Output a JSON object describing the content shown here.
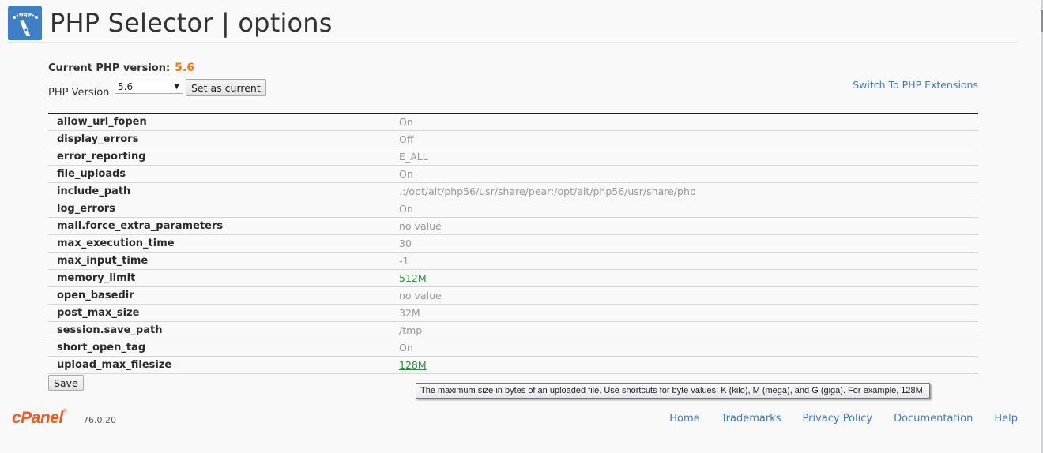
{
  "header": {
    "logo_icon": "php-selector-gauge-icon",
    "title": "PHP Selector | options"
  },
  "version": {
    "current_label": "Current PHP version:",
    "current_value": "5.6",
    "select_label": "PHP Version",
    "selected": "5.6",
    "set_current_label": "Set as current",
    "switch_link": "Switch To PHP Extensions"
  },
  "options": [
    {
      "name": "allow_url_fopen",
      "value": "On",
      "state": "default"
    },
    {
      "name": "display_errors",
      "value": "Off",
      "state": "default"
    },
    {
      "name": "error_reporting",
      "value": "E_ALL",
      "state": "default"
    },
    {
      "name": "file_uploads",
      "value": "On",
      "state": "default"
    },
    {
      "name": "include_path",
      "value": ".:/opt/alt/php56/usr/share/pear:/opt/alt/php56/usr/share/php",
      "state": "default"
    },
    {
      "name": "log_errors",
      "value": "On",
      "state": "default"
    },
    {
      "name": "mail.force_extra_parameters",
      "value": "no value",
      "state": "default"
    },
    {
      "name": "max_execution_time",
      "value": "30",
      "state": "default"
    },
    {
      "name": "max_input_time",
      "value": "-1",
      "state": "default"
    },
    {
      "name": "memory_limit",
      "value": "512M",
      "state": "changed"
    },
    {
      "name": "open_basedir",
      "value": "no value",
      "state": "default"
    },
    {
      "name": "post_max_size",
      "value": "32M",
      "state": "default"
    },
    {
      "name": "session.save_path",
      "value": "/tmp",
      "state": "default"
    },
    {
      "name": "short_open_tag",
      "value": "On",
      "state": "default"
    },
    {
      "name": "upload_max_filesize",
      "value": "128M",
      "state": "changed-hover"
    }
  ],
  "save_label": "Save",
  "tooltip": "The maximum size in bytes of an uploaded file. Use shortcuts for byte values: K (kilo), M (mega), and G (giga). For example, 128M.",
  "footer": {
    "brand": "cPanel",
    "version": "76.0.20",
    "links": [
      "Home",
      "Trademarks",
      "Privacy Policy",
      "Documentation",
      "Help"
    ]
  },
  "colors": {
    "accent_orange": "#f0761e",
    "link_blue": "#3d79bf",
    "changed_green": "#2e8b3a",
    "default_gray": "#999999"
  }
}
